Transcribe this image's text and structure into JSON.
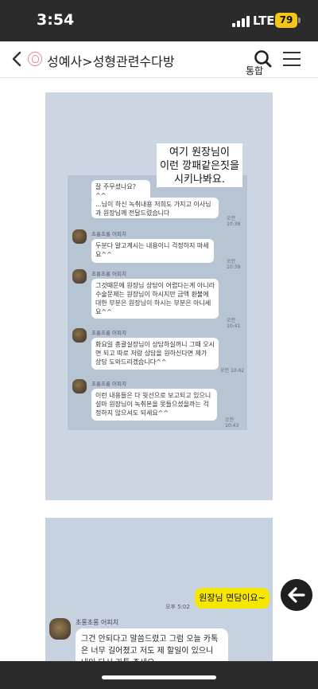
{
  "status": {
    "time": "3:54",
    "network": "LTE",
    "battery": "79"
  },
  "topbar": {
    "breadcrumb": "성예사>성형관련수다방",
    "search_label": "통합"
  },
  "post": {
    "image1": {
      "note": [
        "여기 원장님이",
        "이런 깡패같은짓을",
        "시키나봐요."
      ],
      "messages": [
        {
          "text": "잘 주무셨나요?^^"
        },
        {
          "text": "...님이 하신 녹취내용 저희도 가지고 이사님과 원장님께 전달드렸습니다",
          "time": "오전 10:38"
        },
        {
          "sender": "초롱초롱 어피치",
          "text": "두분다 알고계시는 내용이니 걱정하지 마세요^^",
          "time": "오전 10:39"
        },
        {
          "sender": "초롱초롱 어피치",
          "text": "그것때문에 원장님 상담이 어렵다는게 아니라 수술문제는 원장님이 하시지만 금액 환불에 대한 부분은 원장님이 하시는 부분은 아니세요^^",
          "time": "오전 10:41"
        },
        {
          "sender": "초롱초롱 어피치",
          "text": "화요일 총괄실장님이 상담하실꺼니 그때 오시면 되고 따로 저랑 상담을 원하신다면 제가 상담 도와드리겠습니다^^",
          "time": "오전 10:42"
        },
        {
          "sender": "초롱초롱 어피치",
          "text": "이런 내용들은 다 윗선으로 보고되고 있으니 설마 원장님이 녹취본을 못들으셨을까는 걱정하지 않으셔도 되세요^^",
          "time": "오전 10:43"
        }
      ]
    },
    "image2": {
      "my_message": "원장님 면담이요~",
      "my_time": "오후 5:02",
      "sender": "초롱초롱 어피치",
      "reply": [
        "그건 안되다고 말씀드렸고 그럼 오늘 카톡",
        "은 너무 길어졌고 저도 제 할일이 있으니",
        "내일 다시 카톡 주세요"
      ]
    }
  },
  "colors": {
    "accent_yellow": "#f7e600",
    "battery": "#f5c518",
    "logo_pink": "#e58a95"
  },
  "icons": {
    "back": "chevron-left-icon",
    "logo": "logo-icon",
    "search": "search-icon",
    "menu": "hamburger-menu-icon",
    "fab": "arrow-left-icon"
  }
}
